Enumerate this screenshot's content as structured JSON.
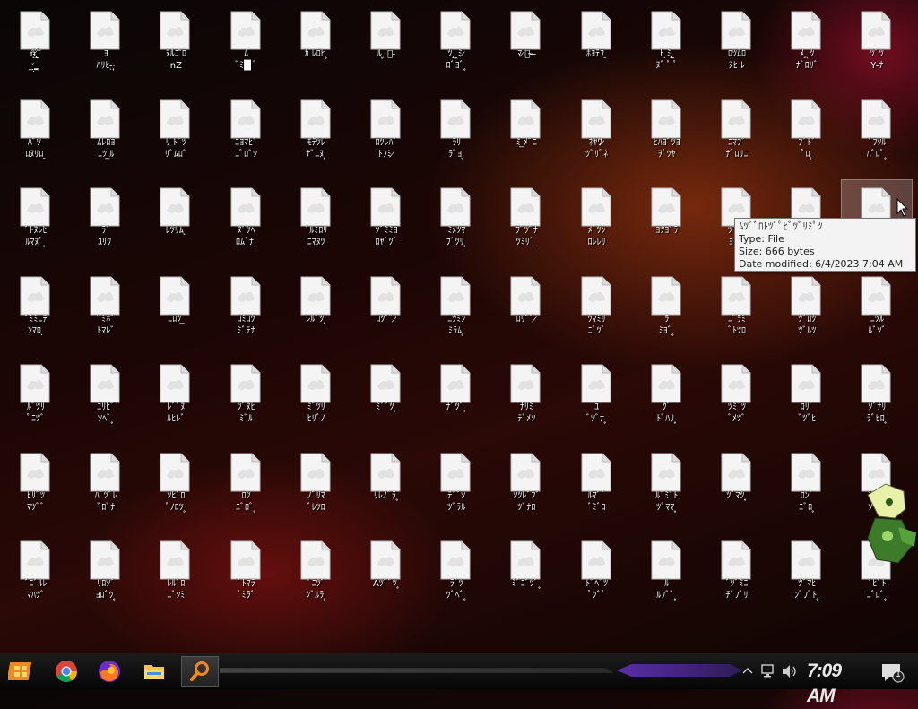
{
  "desktop": {
    "icon_labels": [
      [
        "ñ̵̨̛ ̢̱̈́ ̃\n̛̲ ̤̦ ̣̳̠",
        "ﾖ\nﾊﾘﾋ ̵ͅ ̴̜ͅ",
        "ﾇﾙﾆ ̃ﾛ\nnZ",
        "ﾑ\nﾞﾐ█ ﾞ",
        "ｶ ﾚﾛﾋ ̥",
        "ﾙ ̬ ̣ﾟ ̵",
        "ﾂ ̧ ̼ﾐ ̷\nﾛﾞﾖﾞ ̥",
        "ﾏ ̷ﾟ ̴ ̶",
        "ﾎﾖﾃﾌ ̠",
        "ﾄ ̣ﾐ ̢̫\nﾇﾞ ﾟ ﾟ",
        "ﾛﾂﾑﾛ\nﾇﾋ ﾚ",
        "ﾒ ̧ ̖ﾂ\nﾅﾞﾛﾘﾞ",
        "ﾂﾞﾂ\nY ̵ﾅ"
      ],
      [
        "ﾊﾞﾂ ̶\nﾛﾇﾘﾛ ̠",
        "ﾑﾚﾛﾖ\nﾆﾂ ̲ﾙ",
        "ﾘ ̶ﾄﾞﾂ\nﾘﾞﾑﾛﾞ",
        "ﾆﾖﾏﾋﾞ\nﾆﾟﾛﾞﾂ",
        "ﾓﾃﾂﾚ\nﾅﾞﾆﾇ ̥",
        "ﾛﾂﾚﾊﾞ\nﾄﾌﾐ ̷",
        "ﾗﾘ\nﾗﾞﾖ ̬",
        "ﾐ ̲ﾒﾞﾆ",
        "ﾈﾔﾜ ̷\nﾂﾞﾘﾟﾈ",
        "ﾋﾊﾖﾞﾂﾖ\nｦﾟﾂﾔ",
        "ﾆﾏﾌﾞ\nﾅﾟﾛﾘﾆ",
        "ﾌﾞﾄﾞ\nﾟﾛ ̥",
        "ﾞﾌﾂﾙ\nﾊﾞﾛﾟ ̥"
      ],
      [
        "ﾞﾄﾇﾚﾋ\nﾙﾏﾇﾟ ̥",
        "ﾗﾞ\nﾕﾘﾜ ̣",
        "ﾚﾂﾘﾑ ̨",
        "ﾇﾟﾂﾍ\nﾛﾑﾞﾅ ̤",
        "ﾞﾙﾐﾛﾘ\nﾆﾏﾇﾂ",
        "ﾂﾞﾐﾐﾖ\nﾛﾔﾞﾂﾞ",
        "ﾐﾒﾂﾏ\nﾌﾞﾂﾘ ̥",
        "ﾌﾞﾂﾞﾅ\nﾂﾐﾘﾞ ̣",
        "ﾒﾞﾂﾝ\nﾛﾚﾚﾘ",
        "ﾖﾂﾖﾞﾗ",
        "ﾂﾞﾐﾛ\nﾖﾞﾘ ̲",
        "ﾐ ̤",
        ""
      ],
      [
        "ﾞﾐﾐﾆﾃ\nﾝﾏﾛ ̣",
        "ﾟﾐﾎﾞ\nﾄﾏﾚﾞ",
        "ﾆﾛﾂ ̲",
        "ﾛﾐﾛﾂ\nﾐﾞﾃﾅ",
        "ﾚﾙﾞﾂ ̥",
        "ﾛﾂﾞﾟ ̷",
        "ﾆﾂﾐﾝ\nﾐﾗﾑ ̥",
        "ﾛﾘﾞﾟ ̷",
        "ﾂﾏﾐﾘ\nﾆﾟﾂﾞ",
        "ﾗ\nﾐﾖﾞ ̥",
        "ﾆﾞﾗﾐ\nﾞﾄﾂﾛ",
        "ﾂﾞﾛﾂ\nﾂﾞﾙﾂ",
        "ﾆﾂﾙ\nﾙﾞﾂﾞ"
      ],
      [
        "ﾙﾞﾂﾘ\nﾟﾆﾂﾞ",
        "ﾕﾘﾋﾞ\nﾂﾍﾞ ̥",
        "ﾚﾞﾞﾇ\nﾙﾋﾚﾞ",
        "ﾂﾞﾇﾋ\nﾐﾞﾙ",
        "ﾐﾞﾂﾘ\nﾋﾘﾞﾉ",
        "ﾐﾞﾞﾂ ̥",
        "ﾅﾞﾂﾞ ̥",
        "ﾅﾘﾐ\nﾃﾞﾒﾂ",
        "ﾕ\nﾞﾂﾞﾅ ̥",
        "ｸﾞ\nﾄﾞﾊﾘ ̥",
        "ﾂﾐﾞﾂ\nﾞﾒﾂﾞ",
        "ﾛﾘﾞ\nﾞﾂﾞﾋ",
        "ﾂﾞﾅﾘ\nﾗﾞﾋﾛ ̥"
      ],
      [
        "ﾋﾘﾞﾂ\nﾏﾂﾞﾞ",
        "ﾊﾞﾂﾞﾚ\nﾞﾛﾞﾅ",
        "ﾂﾋﾞﾛ\nﾟﾉﾛﾂ ̥",
        "ﾛﾂ\nﾆﾞﾛﾞ ̥",
        "ﾉﾞﾘﾏ\nﾞﾚﾂﾛ",
        "ﾘﾚﾉﾞﾗ ̥",
        "ﾃﾞﾞﾂ\nﾂﾞﾗﾙ",
        "ﾂﾂﾚﾞﾌﾞ\nﾂﾞﾅﾛ",
        "ﾙﾏﾞﾞ\nﾞﾐﾞﾛ",
        "ﾙﾞﾐﾞﾄ\nﾂﾞﾏﾏ ̥",
        "ﾂﾞﾏﾂ ̥",
        "ﾛﾝﾞ\nﾆﾞﾛ ̥",
        "ﾟﾆﾂﾞ\nﾂﾞﾛﾞ"
      ],
      [
        "ﾞﾆﾞﾙﾚ\nﾏﾊﾂﾞ",
        "ﾘﾛﾂﾞ\nﾖﾛﾞﾂ ̥",
        "ﾚﾙﾞﾛ\nﾆﾞﾂﾐ",
        "ﾞﾄﾏﾗ\nﾞﾐﾗﾞ",
        "ﾟﾆﾂﾞ\nﾂﾞﾙﾗ ̥",
        "Aﾂﾞﾞﾂ ̥",
        "ﾗﾞﾂ\nﾂﾞﾍﾞ ̥",
        "ﾐﾞﾆﾞﾂﾞ ̥",
        "ﾄﾞﾍﾞﾂ\nﾟﾂﾞﾞ",
        "ﾙ\nﾙﾌﾞﾞ ̥",
        "ﾞﾂﾞﾐﾆ\nﾁﾞﾌﾞﾘ",
        "ﾂﾞﾏﾋ\nﾝﾞﾌﾞﾄ ̥",
        "ﾟﾋﾞﾄ\nﾆﾞﾛﾞ ̥"
      ]
    ]
  },
  "tooltip": {
    "name_line": "ﾑﾂﾞﾞﾛﾄﾂﾞﾟﾋﾞﾂﾞﾘﾐﾟﾂ",
    "type_line": "Type: File",
    "size_line": "Size: 666 bytes",
    "modified_line": "Date modified: 6/4/2023 7:04 AM"
  },
  "taskbar": {
    "clock": "7:09 AM",
    "notification_count": "1",
    "pinned": [
      "start-icon",
      "chrome-icon",
      "firefox-icon",
      "file-explorer-icon",
      "search-icon"
    ]
  },
  "colors": {
    "clock_text": "#e9e9e9",
    "deco_purple": "#5a2ea8",
    "search_icon": "#f08a1e"
  }
}
